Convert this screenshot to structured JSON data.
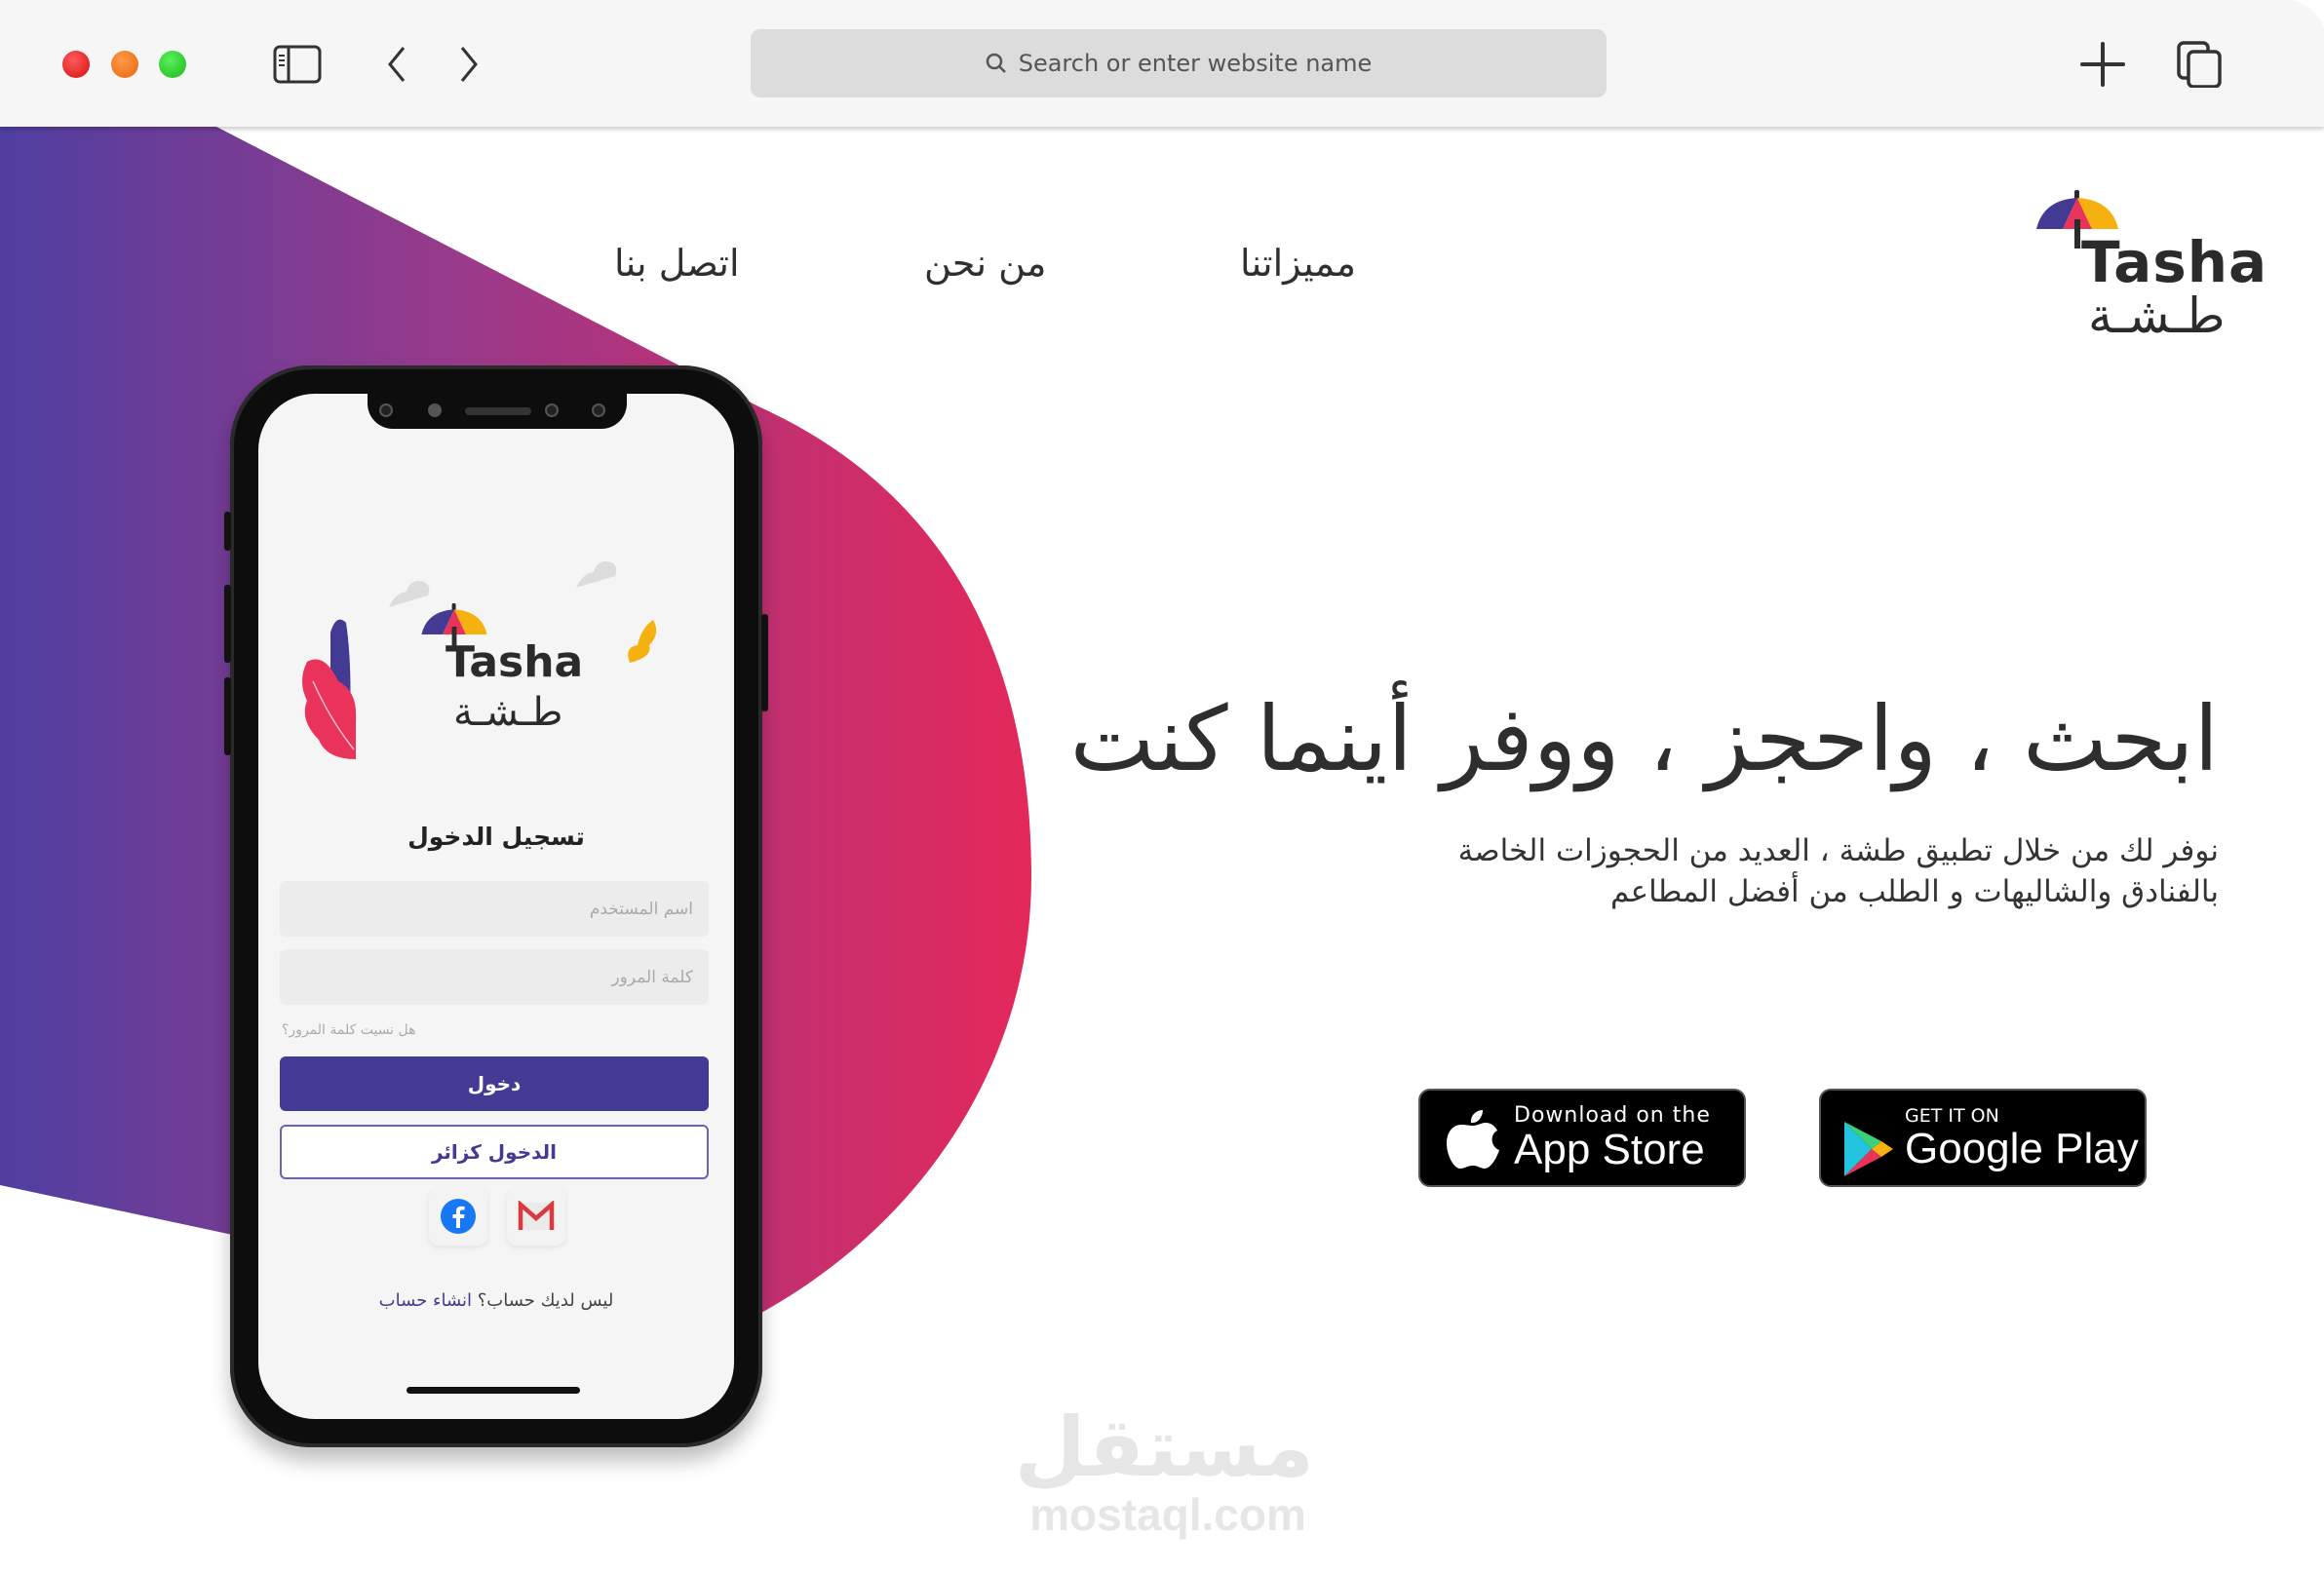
{
  "browser": {
    "address_placeholder": "Search or enter website name",
    "icons": [
      "sidebar-icon",
      "back-icon",
      "forward-icon",
      "new-tab-icon",
      "tabs-overview-icon",
      "search-icon"
    ]
  },
  "logo": {
    "en": "Tasha",
    "ar": "طـشـة"
  },
  "nav": {
    "items": [
      {
        "label": "مميزاتنا"
      },
      {
        "label": "من نحن"
      },
      {
        "label": "اتصل بنا"
      }
    ]
  },
  "hero": {
    "title": "ابحث ، واحجز ، ووفر أينما كنت",
    "subtitle_line1": "نوفر لك من خلال تطبيق طشة ، العديد من الحجوزات الخاصة",
    "subtitle_line2": "بالفنادق والشاليهات و الطلب من أفضل المطاعم"
  },
  "stores": {
    "apple": {
      "small": "Download on the",
      "big": "App Store"
    },
    "google": {
      "small": "GET IT ON",
      "big": "Google Play"
    }
  },
  "phone": {
    "logo_en": "Tasha",
    "logo_ar": "طـشـة",
    "title": "تسجيل الدخول",
    "username_placeholder": "اسم المستخدم",
    "password_placeholder": "كلمة المرور",
    "forgot": "هل نسيت كلمة المرور؟",
    "login": "دخول",
    "guest": "الدخول كزائر",
    "no_account": "ليس لديك حساب؟",
    "create_account": "انشاء حساب"
  },
  "colors": {
    "gradient_start": "#4f3fa0",
    "gradient_end": "#e4285a",
    "primary": "#433a93",
    "umbrella": [
      "#433a93",
      "#e9335a",
      "#f4b10f"
    ]
  },
  "watermark": {
    "ar": "مستقل",
    "en": "mostaql.com"
  }
}
